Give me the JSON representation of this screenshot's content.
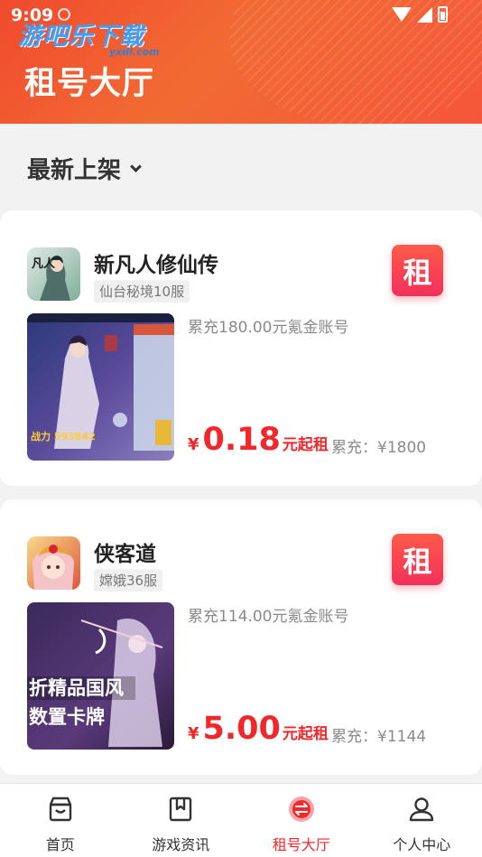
{
  "status_bar": {
    "time": "9:09"
  },
  "watermark": {
    "text": "游吧乐下载",
    "sub": "yxdl.com"
  },
  "header": {
    "title": "租号大厅"
  },
  "filter": {
    "label": "最新上架"
  },
  "listings": [
    {
      "name": "新凡人修仙传",
      "server": "仙台秘境10服",
      "badge": "租",
      "description": "累充180.00元氪金账号",
      "currency": "¥",
      "price": "0.18",
      "unit": "元起租",
      "total": "累充：¥1800",
      "shot_overlay": "战力 593842",
      "icon_text": "凡人"
    },
    {
      "name": "侠客道",
      "server": "嫦娥36服",
      "badge": "租",
      "description": "累充114.00元氪金账号",
      "currency": "¥",
      "price": "5.00",
      "unit": "元起租",
      "total": "累充：¥1144",
      "shot_overlay": "折精品国风",
      "shot_overlay2": "数置卡牌"
    }
  ],
  "tabs": [
    {
      "label": "首页",
      "icon": "store-icon"
    },
    {
      "label": "游戏资讯",
      "icon": "book-icon"
    },
    {
      "label": "租号大厅",
      "icon": "exchange-icon",
      "active": true
    },
    {
      "label": "个人中心",
      "icon": "user-icon"
    }
  ],
  "colors": {
    "accent": "#f0282c",
    "header": "#f2582f"
  }
}
